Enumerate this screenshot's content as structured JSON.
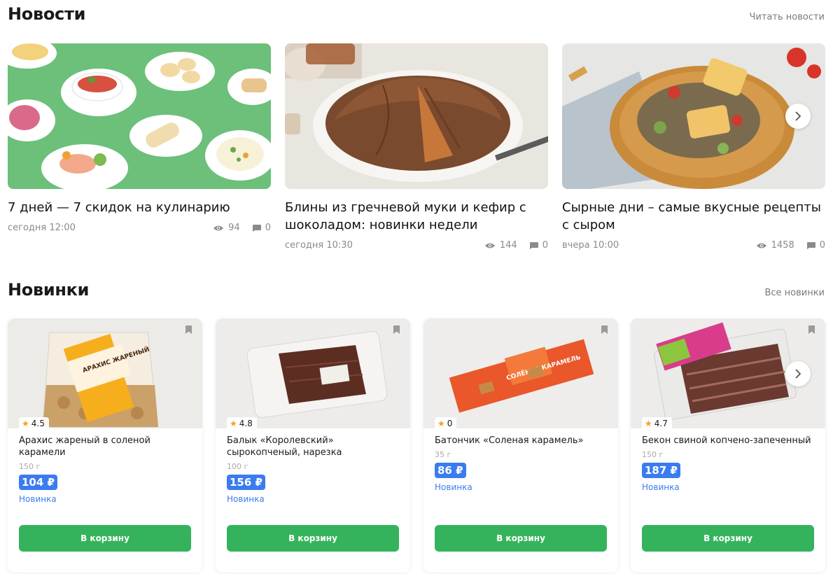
{
  "news": {
    "title": "Новости",
    "link": "Читать новости",
    "items": [
      {
        "title": "7 дней — 7 скидок на кулинарию",
        "time": "сегодня 12:00",
        "views": "94",
        "comments": "0"
      },
      {
        "title": "Блины из гречневой муки и кефир с шоколадом: новинки недели",
        "time": "сегодня 10:30",
        "views": "144",
        "comments": "0"
      },
      {
        "title": "Сырные дни – самые вкусные рецепты с сыром",
        "time": "вчера 10:00",
        "views": "1458",
        "comments": "0"
      }
    ]
  },
  "products": {
    "title": "Новинки",
    "link": "Все новинки",
    "items": [
      {
        "rating": "4.5",
        "name": "Арахис жареный в соленой карамели",
        "weight": "150 г",
        "price": "104 ₽",
        "badge": "Новинка",
        "button": "В корзину",
        "package_text": "АРАХИС ЖАРЕНЫЙ"
      },
      {
        "rating": "4.8",
        "name": "Балык «Королевский» сырокопченый, нарезка",
        "weight": "100 г",
        "price": "156 ₽",
        "badge": "Новинка",
        "button": "В корзину"
      },
      {
        "rating": "0",
        "name": "Батончик «Соленая карамель»",
        "weight": "35 г",
        "price": "86 ₽",
        "badge": "Новинка",
        "button": "В корзину",
        "package_text": "СОЛЁНАЯ КАРАМЕЛЬ"
      },
      {
        "rating": "4.7",
        "name": "Бекон свиной копчено-запеченный",
        "weight": "150 г",
        "price": "187 ₽",
        "badge": "Новинка",
        "button": "В корзину"
      }
    ]
  },
  "colors": {
    "price_bg": "#3a7cf0",
    "button_bg": "#35b35c",
    "star": "#f2a516",
    "news_green": "#6cc07a"
  },
  "icons": {
    "views": "eye-icon",
    "comments": "comment-icon",
    "bookmark": "bookmark-icon",
    "next": "chevron-right-icon",
    "star": "star-icon"
  }
}
